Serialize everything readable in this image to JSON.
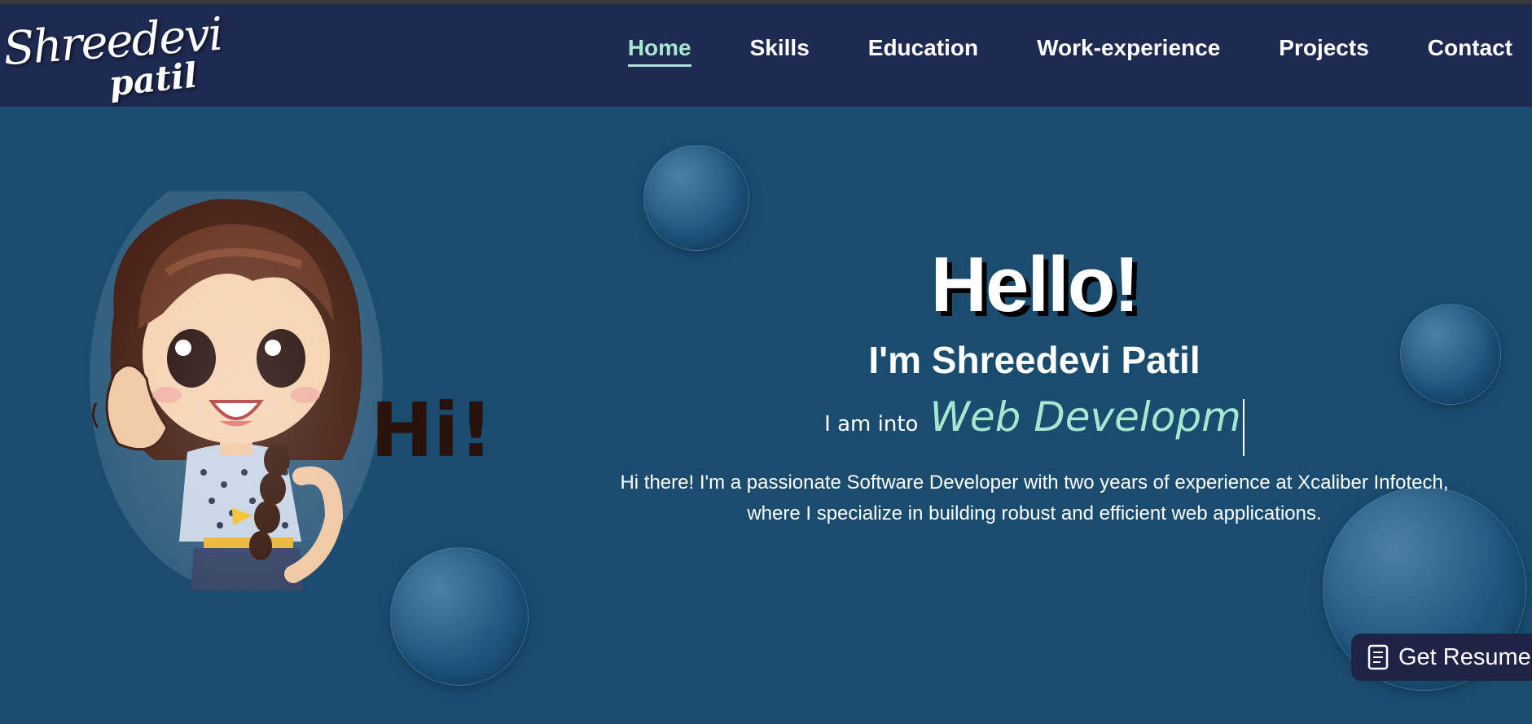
{
  "logo": {
    "line1": "Shreedevi",
    "line2": "patil"
  },
  "nav": {
    "items": [
      {
        "label": "Home",
        "active": true
      },
      {
        "label": "Skills",
        "active": false
      },
      {
        "label": "Education",
        "active": false
      },
      {
        "label": "Work-experience",
        "active": false
      },
      {
        "label": "Projects",
        "active": false
      },
      {
        "label": "Contact",
        "active": false
      }
    ]
  },
  "hero": {
    "greeting": "Hello!",
    "name": "I'm Shreedevi Patil",
    "into_label": "I am into",
    "typed_text": "Web Developm",
    "description": "Hi there! I'm a passionate Software Developer with two years of experience at Xcaliber Infotech, where I specialize in building robust and efficient web applications."
  },
  "avatar": {
    "bubble_text": "Hi!"
  },
  "resume_button": {
    "label": "Get Resume",
    "icon": "document-icon"
  },
  "colors": {
    "navbar_bg": "#1e2a52",
    "page_bg": "#1a4c70",
    "accent": "#a8e6cf",
    "button_bg": "#1f2346"
  }
}
